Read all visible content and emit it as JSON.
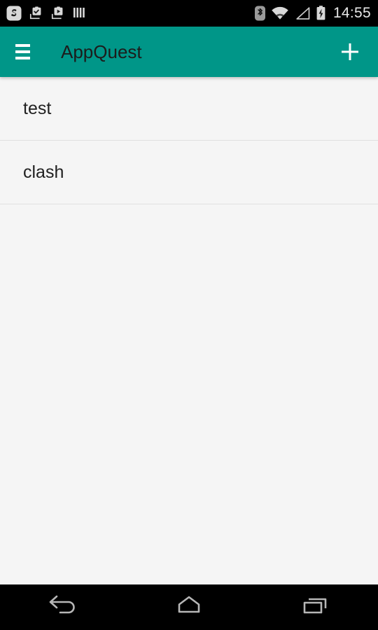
{
  "status_bar": {
    "clock": "14:55",
    "background": "#000000",
    "left_icons": [
      {
        "name": "app-notification-icon",
        "label": "S"
      },
      {
        "name": "download-complete-icon",
        "label": ""
      },
      {
        "name": "download-play-icon",
        "label": ""
      },
      {
        "name": "bars-notification-icon",
        "label": ""
      }
    ],
    "right_icons": [
      {
        "name": "bluetooth-icon",
        "label": ""
      },
      {
        "name": "wifi-icon",
        "label": ""
      },
      {
        "name": "cellular-signal-icon",
        "label": ""
      },
      {
        "name": "battery-charging-icon",
        "label": ""
      }
    ]
  },
  "app_bar": {
    "title": "AppQuest",
    "menu_icon": "hamburger-icon",
    "add_icon": "plus-icon",
    "background": "#009688",
    "title_color": "#1c1c1c"
  },
  "list": {
    "items": [
      {
        "label": "test"
      },
      {
        "label": "clash"
      }
    ],
    "background": "#f5f5f5",
    "divider_color": "#e0e0e0"
  },
  "nav_bar": {
    "background": "#000000",
    "buttons": [
      {
        "name": "back-button",
        "icon": "back-arrow-icon"
      },
      {
        "name": "home-button",
        "icon": "home-icon"
      },
      {
        "name": "recents-button",
        "icon": "recents-icon"
      }
    ]
  }
}
